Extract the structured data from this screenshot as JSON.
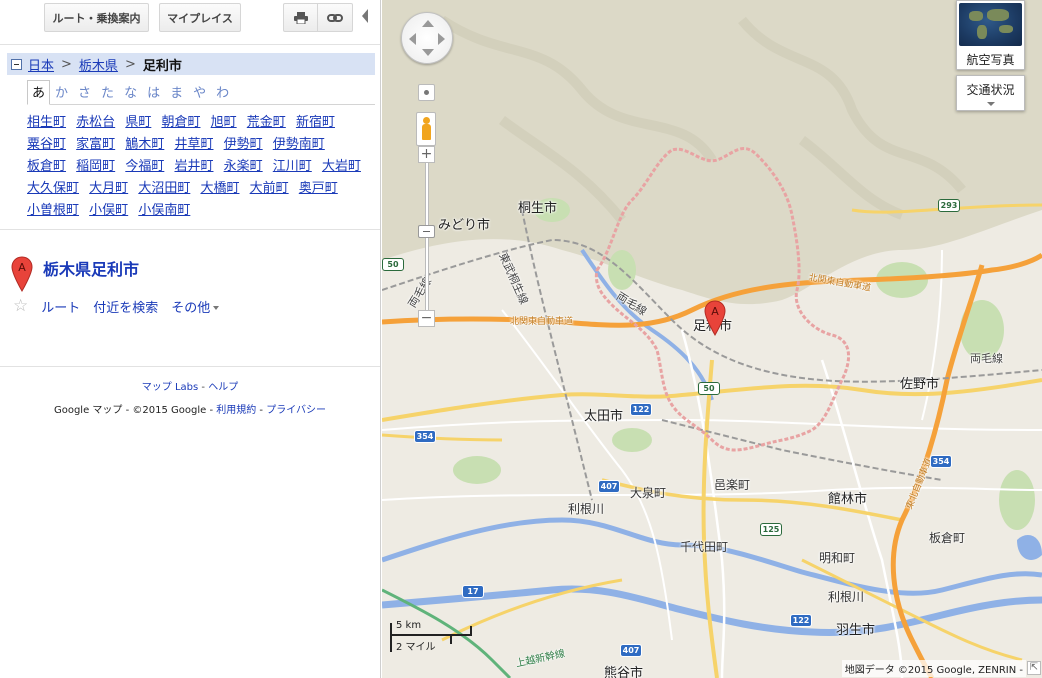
{
  "toolbar": {
    "route_label": "ルート・乗換案内",
    "myplaces_label": "マイプレイス",
    "print_icon": "printer-icon",
    "link_icon": "link-icon"
  },
  "breadcrumb": {
    "items": [
      "日本",
      "栃木県"
    ],
    "current": "足利市",
    "separator": ">"
  },
  "kana_tabs": [
    "あ",
    "か",
    "さ",
    "た",
    "な",
    "は",
    "ま",
    "や",
    "わ"
  ],
  "active_kana_tab": "あ",
  "towns": [
    "相生町",
    "赤松台",
    "県町",
    "朝倉町",
    "旭町",
    "荒金町",
    "新宿町",
    "粟谷町",
    "家富町",
    "鵤木町",
    "井草町",
    "伊勢町",
    "伊勢南町",
    "板倉町",
    "稲岡町",
    "今福町",
    "岩井町",
    "永楽町",
    "江川町",
    "大岩町",
    "大久保町",
    "大月町",
    "大沼田町",
    "大橋町",
    "大前町",
    "奥戸町",
    "小曽根町",
    "小俣町",
    "小俣南町"
  ],
  "result": {
    "marker_letter": "A",
    "title": "栃木県足利市",
    "actions": [
      "ルート",
      "付近を検索",
      "その他"
    ]
  },
  "footer": {
    "maplabs": "マップ Labs",
    "dash": " - ",
    "help": "ヘルプ",
    "copy_prefix": "Google マップ - ©2015 Google - ",
    "terms": "利用規約",
    "privacy": "プライバシー"
  },
  "map": {
    "aerial_label": "航空写真",
    "traffic_label": "交通状況",
    "marker_letter": "A",
    "scale_km": "5 km",
    "scale_mi": "2 マイル",
    "attribution": "地図データ ©2015 Google, ZENRIN -",
    "labels": {
      "midori": "みどり市",
      "kiryu": "桐生市",
      "ashikaga": "足利市",
      "sano": "佐野市",
      "ota": "太田市",
      "oizumi": "大泉町",
      "ora": "邑楽町",
      "tatebayashi": "館林市",
      "itakura": "板倉町",
      "chiyoda": "千代田町",
      "meiwa": "明和町",
      "hanyu": "羽生市",
      "kumagaya": "熊谷市",
      "tonegawa1": "利根川",
      "tonegawa2": "利根川",
      "ryomo1": "両毛線",
      "ryomo2": "両毛線",
      "ryomo3": "両毛線",
      "tobu_kiryu": "東武桐生線",
      "kitakanto1": "北関東自動車道",
      "kitakanto2": "北関東自動車道",
      "tohoku_exp": "東北自動車道",
      "joetsu": "上越新幹線"
    },
    "shields": {
      "r293": "293",
      "r50a": "50",
      "r50b": "50",
      "r122a": "122",
      "r122b": "122",
      "r354a": "354",
      "r354b": "354",
      "r407a": "407",
      "r407b": "407",
      "r17": "17",
      "r125": "125"
    },
    "colors": {
      "background": "#eeebe3",
      "mountain": "#dcd9c7",
      "green": "#c8dfb2",
      "water": "#8fb1e6",
      "expressway": "#f5a13a",
      "boundary": "#e8a3a3",
      "road": "#ffffff",
      "rail": "#9a9a9a"
    }
  }
}
